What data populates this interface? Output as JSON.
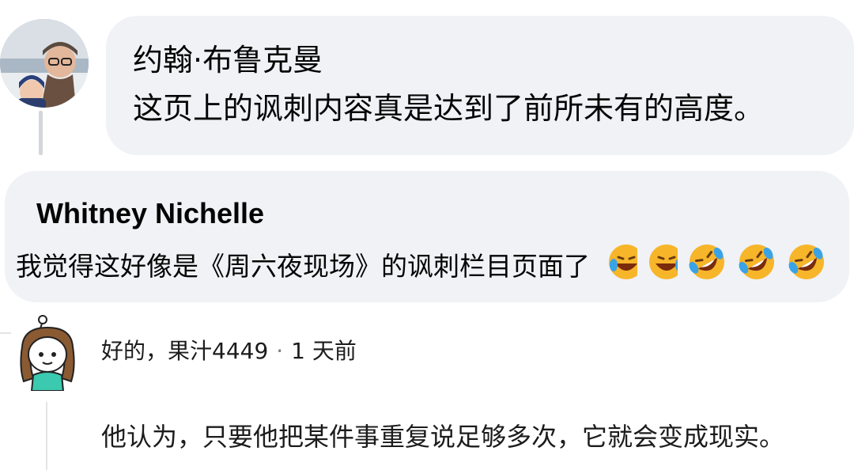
{
  "comments": [
    {
      "author": "约翰·布鲁克曼",
      "text": "这页上的讽刺内容真是达到了前所未有的高度。"
    },
    {
      "author": "Whitney Nichelle",
      "text": "我觉得这好像是《周六夜现场》的讽刺栏目页面了",
      "emojis": [
        "rolling-on-floor-laughing-emoji",
        "rolling-on-floor-laughing-emoji",
        "rolling-on-floor-laughing-emoji",
        "rolling-on-floor-laughing-emoji",
        "rolling-on-floor-laughing-emoji"
      ]
    },
    {
      "author": "好的，果汁4449",
      "separator": "·",
      "time": "1 天前",
      "text": "他认为，只要他把某件事重复说足够多次，它就会变成现实。"
    }
  ],
  "colors": {
    "bubble_bg": "#f0f2f5",
    "text": "#050505",
    "thread_line": "#d3d6db",
    "emoji_face": "#f7b52a",
    "emoji_tear": "#3aa3e6"
  }
}
